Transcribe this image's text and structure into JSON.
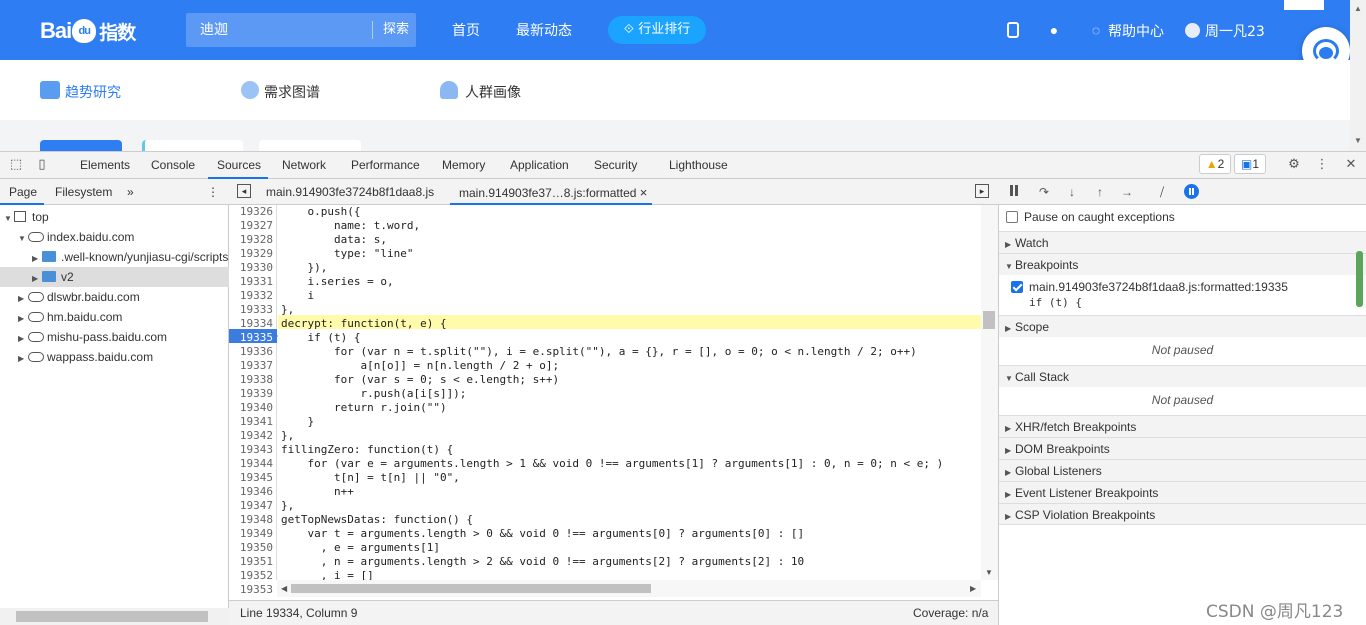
{
  "site": {
    "logo_text": "Bai",
    "logo_paw": "du",
    "logo_zh": "指数",
    "search_value": "迪迦",
    "search_button": "探索",
    "nav": [
      "首页",
      "最新动态"
    ],
    "rank_button": "行业排行",
    "help": "帮助中心",
    "user": "周一凡23",
    "subnav": [
      "趋势研究",
      "需求图谱",
      "人群画像"
    ]
  },
  "devtools": {
    "tabs": [
      "Elements",
      "Console",
      "Sources",
      "Network",
      "Performance",
      "Memory",
      "Application",
      "Security",
      "Lighthouse"
    ],
    "warnings": "2",
    "messages": "1",
    "left_tabs": [
      "Page",
      "Filesystem"
    ],
    "tree": [
      {
        "label": "top",
        "type": "frame",
        "arrow": "▼",
        "indent": 0
      },
      {
        "label": "index.baidu.com",
        "type": "cloud",
        "arrow": "▼",
        "indent": 1
      },
      {
        "label": ".well-known/yunjiasu-cgi/scripts",
        "type": "folder",
        "arrow": "▶",
        "indent": 2
      },
      {
        "label": "v2",
        "type": "folder",
        "arrow": "▶",
        "indent": 2
      },
      {
        "label": "dlswbr.baidu.com",
        "type": "cloud",
        "arrow": "▶",
        "indent": 1
      },
      {
        "label": "hm.baidu.com",
        "type": "cloud",
        "arrow": "▶",
        "indent": 1
      },
      {
        "label": "mishu-pass.baidu.com",
        "type": "cloud",
        "arrow": "▶",
        "indent": 1
      },
      {
        "label": "wappass.baidu.com",
        "type": "cloud",
        "arrow": "▶",
        "indent": 1
      }
    ],
    "editor_tabs": [
      "main.914903fe3724b8f1daa8.js",
      "main.914903fe37…8.js:formatted"
    ],
    "close_glyph": "×",
    "code_lines": [
      {
        "n": "19326",
        "t": "    o.push({"
      },
      {
        "n": "19327",
        "t": "        name: t.word,"
      },
      {
        "n": "19328",
        "t": "        data: s,"
      },
      {
        "n": "19329",
        "t": "        type: \"line\""
      },
      {
        "n": "19330",
        "t": "    }),"
      },
      {
        "n": "19331",
        "t": "    i.series = o,"
      },
      {
        "n": "19332",
        "t": "    i"
      },
      {
        "n": "19333",
        "t": "},"
      },
      {
        "n": "19334",
        "t": "decrypt: function(t, e) {"
      },
      {
        "n": "19335",
        "t": "    if (t) {"
      },
      {
        "n": "19336",
        "t": "        for (var n = t.split(\"\"), i = e.split(\"\"), a = {}, r = [], o = 0; o < n.length / 2; o++)"
      },
      {
        "n": "19337",
        "t": "            a[n[o]] = n[n.length / 2 + o];"
      },
      {
        "n": "19338",
        "t": "        for (var s = 0; s < e.length; s++)"
      },
      {
        "n": "19339",
        "t": "            r.push(a[i[s]]);"
      },
      {
        "n": "19340",
        "t": "        return r.join(\"\")"
      },
      {
        "n": "19341",
        "t": "    }"
      },
      {
        "n": "19342",
        "t": "},"
      },
      {
        "n": "19343",
        "t": "fillingZero: function(t) {"
      },
      {
        "n": "19344",
        "t": "    for (var e = arguments.length > 1 && void 0 !== arguments[1] ? arguments[1] : 0, n = 0; n < e; )"
      },
      {
        "n": "19345",
        "t": "        t[n] = t[n] || \"0\","
      },
      {
        "n": "19346",
        "t": "        n++"
      },
      {
        "n": "19347",
        "t": "},"
      },
      {
        "n": "19348",
        "t": "getTopNewsDatas: function() {"
      },
      {
        "n": "19349",
        "t": "    var t = arguments.length > 0 && void 0 !== arguments[0] ? arguments[0] : []"
      },
      {
        "n": "19350",
        "t": "      , e = arguments[1]"
      },
      {
        "n": "19351",
        "t": "      , n = arguments.length > 2 && void 0 !== arguments[2] ? arguments[2] : 10"
      },
      {
        "n": "19352",
        "t": "      , i = []"
      },
      {
        "n": "19353",
        "t": ""
      }
    ],
    "status_position": "Line 19334, Column 9",
    "status_coverage": "Coverage: n/a",
    "pause_caught": "Pause on caught exceptions",
    "sections": {
      "watch": "Watch",
      "breakpoints": "Breakpoints",
      "scope": "Scope",
      "call_stack": "Call Stack",
      "xhr": "XHR/fetch Breakpoints",
      "dom": "DOM Breakpoints",
      "global": "Global Listeners",
      "event": "Event Listener Breakpoints",
      "csp": "CSP Violation Breakpoints"
    },
    "breakpoint_file": "main.914903fe3724b8f1daa8.js:formatted:19335",
    "breakpoint_code": "if (t) {",
    "not_paused": "Not paused"
  },
  "watermark": "CSDN @周凡123",
  "colors": {
    "baidu_blue": "#2f7df2",
    "accent": "#1a73e8",
    "highlight": "#fffbaa"
  }
}
